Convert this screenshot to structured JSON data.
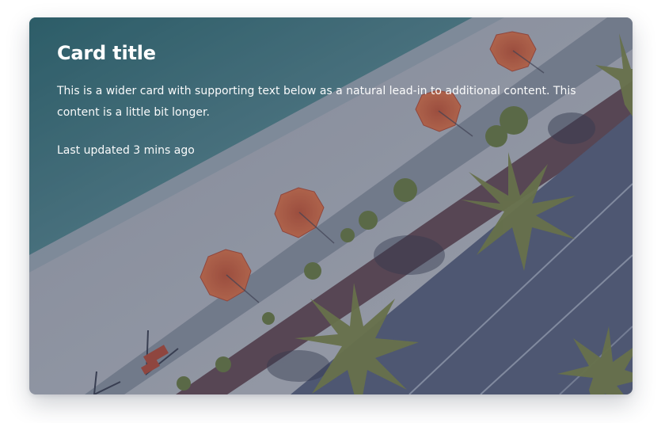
{
  "card": {
    "title": "Card title",
    "text": "This is a wider card with supporting text below as a natural lead-in to additional content. This content is a little bit longer.",
    "updated": "Last updated 3 mins ago",
    "image": {
      "subject": "aerial beach scene with umbrellas and palm trees",
      "colors": {
        "sea": "#3f7f86",
        "sand": "#b9bdc8",
        "umbrella": "#d9684a",
        "road": "#5d6784",
        "promenade": "#6a4f5a",
        "palm": "#7f8a4e"
      }
    }
  }
}
